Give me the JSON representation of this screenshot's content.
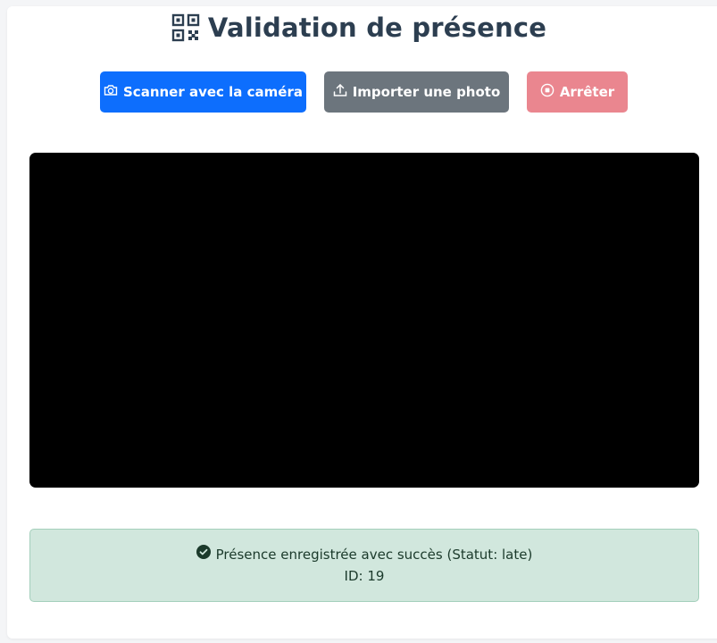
{
  "page": {
    "title": "Validation de présence",
    "title_icon": "qr-code-icon"
  },
  "toolbar": {
    "scan_label": "Scanner avec la caméra",
    "scan_icon": "camera-icon",
    "import_label": "Importer une photo",
    "import_icon": "upload-icon",
    "stop_label": "Arrêter",
    "stop_icon": "stop-circle-icon"
  },
  "alert": {
    "message": "Présence enregistrée avec succès (Statut: late)",
    "id_text": "ID: 19",
    "icon": "check-circle-icon"
  },
  "colors": {
    "primary": "#0d6efd",
    "secondary": "#6c757d",
    "danger_disabled": "#ea868f",
    "success_bg": "#d1e7dd",
    "title": "#2c3e50"
  }
}
